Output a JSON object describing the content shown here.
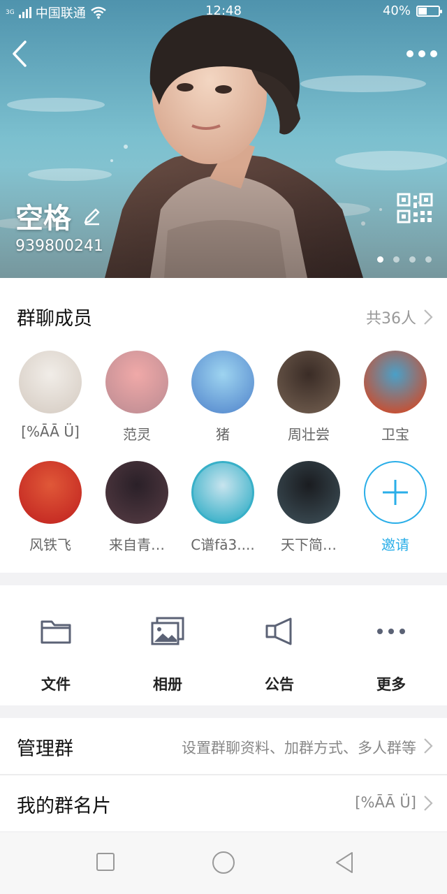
{
  "status_bar": {
    "signal_tag": "3G",
    "carrier": "中国联通",
    "time": "12:48",
    "battery": "40%",
    "battery_level": 0.4
  },
  "hero": {
    "group_name": "空格",
    "group_id": "939800241",
    "page_count": 4,
    "active_page": 0
  },
  "members": {
    "title": "群聊成员",
    "count_label": "共36人",
    "list": [
      {
        "name": "[%ĀĀ Ü]",
        "avatar_colors": [
          "#f1ede8",
          "#d8cfc6"
        ]
      },
      {
        "name": "范灵",
        "avatar_colors": [
          "#f0a9a8",
          "#c28f95"
        ]
      },
      {
        "name": "猪",
        "avatar_colors": [
          "#9ed4f0",
          "#5a8ed0"
        ]
      },
      {
        "name": "周壮尝",
        "avatar_colors": [
          "#3a2c26",
          "#6d5a4c"
        ]
      },
      {
        "name": "卫宝",
        "avatar_colors": [
          "#4aa0c8",
          "#d04a28"
        ]
      },
      {
        "name": "风铁飞",
        "avatar_colors": [
          "#e05838",
          "#c42822"
        ]
      },
      {
        "name": "来自青…",
        "avatar_colors": [
          "#2a2028",
          "#503840"
        ]
      },
      {
        "name": "C谱fă3....",
        "avatar_colors": [
          "#c8e4ee",
          "#38b0c8"
        ]
      },
      {
        "name": "天下简…",
        "avatar_colors": [
          "#1a1c20",
          "#3a4a52"
        ]
      }
    ],
    "invite_label": "邀请"
  },
  "tools": [
    {
      "label": "文件",
      "icon": "folder-icon"
    },
    {
      "label": "相册",
      "icon": "photo-album-icon"
    },
    {
      "label": "公告",
      "icon": "megaphone-icon"
    },
    {
      "label": "更多",
      "icon": "more-dots-icon"
    }
  ],
  "settings": {
    "manage": {
      "label": "管理群",
      "value": "设置群聊资料、加群方式、多人群等"
    },
    "card": {
      "label": "我的群名片",
      "value": "[%ĀĀ Ü]"
    }
  },
  "colors": {
    "accent": "#2aaee8",
    "icon_gray": "#5b6275"
  }
}
